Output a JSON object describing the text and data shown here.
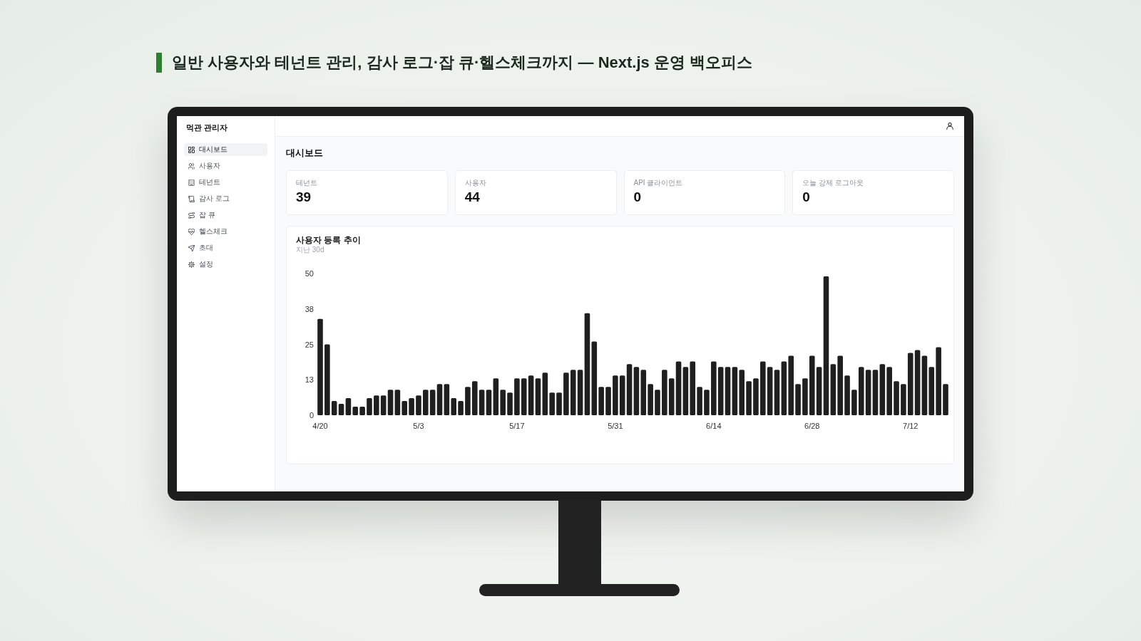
{
  "headline": "일반 사용자와 테넌트 관리, 감사 로그·잡 큐·헬스체크까지 — Next.js 운영 백오피스",
  "app": {
    "sidebar": {
      "title": "먹관 관리자",
      "items": [
        {
          "label": "대시보드",
          "selected": true
        },
        {
          "label": "사용자",
          "selected": false
        },
        {
          "label": "테넌트",
          "selected": false
        },
        {
          "label": "감사 로그",
          "selected": false
        },
        {
          "label": "잡 큐",
          "selected": false
        },
        {
          "label": "헬스체크",
          "selected": false
        },
        {
          "label": "초대",
          "selected": false
        },
        {
          "label": "설정",
          "selected": false
        }
      ]
    },
    "page_title": "대시보드",
    "stats": [
      {
        "label": "테넌트",
        "value": "39"
      },
      {
        "label": "사용자",
        "value": "44"
      },
      {
        "label": "API 클라이언트",
        "value": "0"
      },
      {
        "label": "오늘 강제 로그아웃",
        "value": "0"
      }
    ],
    "chart_card": {
      "title": "사용자 등록 추이",
      "subtitle": "지난 30d",
      "chart_data": {
        "type": "bar",
        "ylim": [
          0,
          50
        ],
        "yticks": [
          {
            "value": 0,
            "label": "0"
          },
          {
            "value": 12.5,
            "label": "13"
          },
          {
            "value": 25,
            "label": "25"
          },
          {
            "value": 37.5,
            "label": "38"
          },
          {
            "value": 50,
            "label": "50"
          }
        ],
        "categories": [
          "4/20",
          null,
          null,
          null,
          null,
          null,
          null,
          null,
          null,
          null,
          null,
          null,
          null,
          null,
          "5/3",
          null,
          null,
          null,
          null,
          null,
          null,
          null,
          null,
          null,
          null,
          null,
          null,
          null,
          "5/17",
          null,
          null,
          null,
          null,
          null,
          null,
          null,
          null,
          null,
          null,
          null,
          null,
          null,
          "5/31",
          null,
          null,
          null,
          null,
          null,
          null,
          null,
          null,
          null,
          null,
          null,
          null,
          null,
          "6/14",
          null,
          null,
          null,
          null,
          null,
          null,
          null,
          null,
          null,
          null,
          null,
          null,
          null,
          "6/28",
          null,
          null,
          null,
          null,
          null,
          null,
          null,
          null,
          null,
          null,
          null,
          null,
          null,
          "7/12",
          null,
          null,
          null,
          null,
          null
        ],
        "values": [
          34,
          25,
          5,
          4,
          6,
          3,
          3,
          6,
          7,
          7,
          9,
          9,
          5,
          6,
          7,
          9,
          9,
          11,
          11,
          6,
          5,
          10,
          12,
          9,
          9,
          13,
          9,
          8,
          13,
          13,
          14,
          13,
          15,
          8,
          8,
          15,
          16,
          16,
          36,
          26,
          10,
          10,
          14,
          14,
          18,
          17,
          16,
          11,
          9,
          16,
          13,
          19,
          17,
          19,
          10,
          9,
          19,
          17,
          17,
          17,
          16,
          12,
          13,
          19,
          17,
          16,
          19,
          21,
          11,
          13,
          21,
          17,
          49,
          18,
          21,
          14,
          9,
          17,
          16,
          16,
          18,
          17,
          12,
          11,
          22,
          23,
          21,
          17,
          24,
          11
        ]
      }
    }
  }
}
